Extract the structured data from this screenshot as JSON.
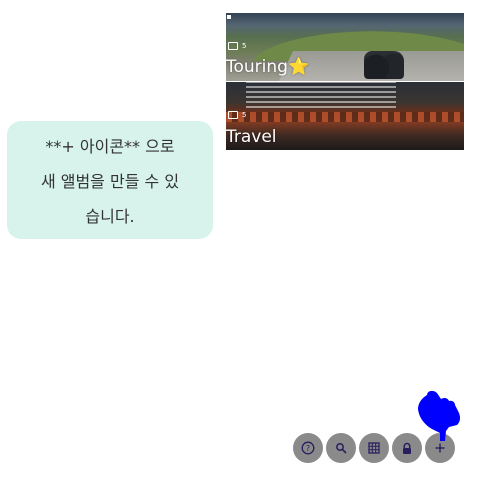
{
  "albums": [
    {
      "name": "Touring⭐",
      "count": "5",
      "icon": "photo-album-icon"
    },
    {
      "name": "Travel",
      "count": "5",
      "icon": "photo-album-icon"
    }
  ],
  "tooltip": {
    "line1": "**+ 아이콘** 으로",
    "line2": "새 앨범을 만들 수 있",
    "line3": "습니다."
  },
  "toolbar": [
    {
      "icon": "help-icon",
      "label": "?"
    },
    {
      "icon": "search-icon"
    },
    {
      "icon": "grid-icon"
    },
    {
      "icon": "lock-icon"
    },
    {
      "icon": "add-icon",
      "label": "+"
    }
  ],
  "colors": {
    "tooltip_bg": "#d7f3ec",
    "toolbar_button": "#8a8a8a",
    "toolbar_icon": "#2a1d5e",
    "pointer": "#0000ff"
  }
}
